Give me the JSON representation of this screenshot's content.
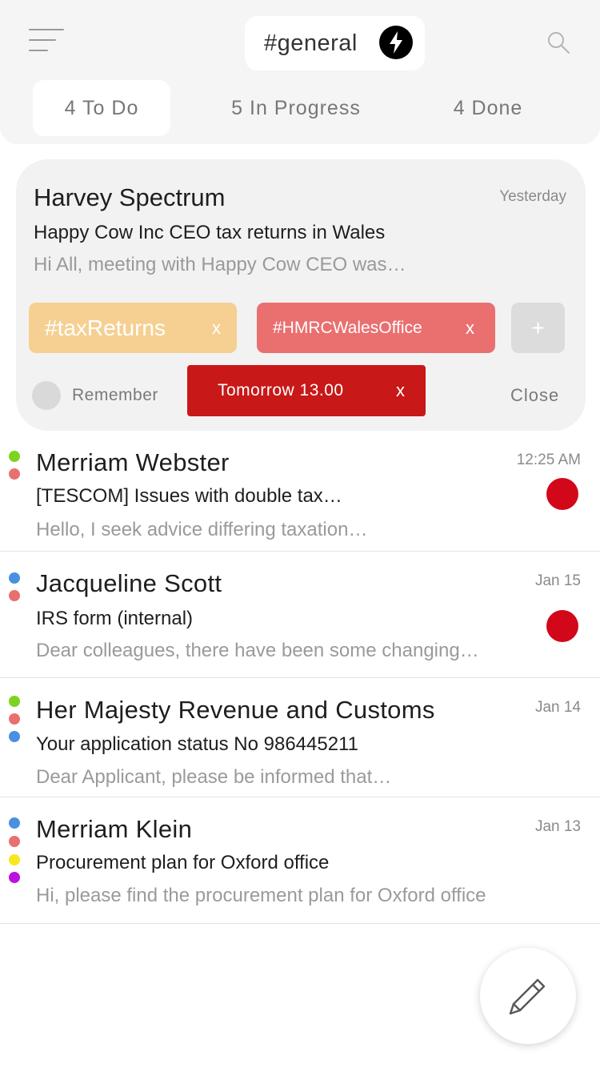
{
  "header": {
    "channel": "#general",
    "tabs": [
      {
        "label": "4 To Do",
        "active": true
      },
      {
        "label": "5 In Progress",
        "active": false
      },
      {
        "label": "4 Done",
        "active": false
      }
    ]
  },
  "expanded_message": {
    "sender": "Harvey Spectrum",
    "time": "Yesterday",
    "subject": "Happy Cow Inc CEO tax returns in Wales",
    "preview": "Hi All, meeting with Happy Cow CEO was…",
    "tags": [
      {
        "label": "#taxReturns",
        "remove": "x",
        "color": "#f5d092"
      },
      {
        "label": "#HMRCWalesOffice",
        "remove": "x",
        "color": "#ea6f6f"
      }
    ],
    "add_tag": "+",
    "remember_label": "Remember",
    "reminder": {
      "label": "Tomorrow 13.00",
      "remove": "x",
      "color": "#c81818"
    },
    "close_label": "Close"
  },
  "messages": [
    {
      "sender": "Merriam Webster",
      "time": "12:25 AM",
      "subject": "[TESCOM] Issues with double tax…",
      "preview": "Hello, I seek advice differing taxation…",
      "label_colors": [
        "#7ed321",
        "#ea6f6f"
      ],
      "unread": true
    },
    {
      "sender": "Jacqueline Scott",
      "time": "Jan 15",
      "subject": "IRS form (internal)",
      "preview": "Dear colleagues, there have been some changing…",
      "label_colors": [
        "#4a90e2",
        "#ea6f6f"
      ],
      "unread": true
    },
    {
      "sender": "Her Majesty Revenue and Customs",
      "time": "Jan 14",
      "subject": "Your application status No 986445211",
      "preview": "Dear Applicant, please be informed that…",
      "label_colors": [
        "#7ed321",
        "#ea6f6f",
        "#4a90e2"
      ],
      "unread": false
    },
    {
      "sender": "Merriam Klein",
      "time": "Jan 13",
      "subject": "Procurement plan for Oxford office",
      "preview": "Hi, please find the procurement plan for Oxford office",
      "label_colors": [
        "#4a90e2",
        "#ea6f6f",
        "#f8e71c",
        "#bd10e0"
      ],
      "unread": false
    }
  ],
  "icons": {
    "menu": "hamburger-menu-icon",
    "channel": "lightning-bolt-icon",
    "search": "search-icon",
    "compose": "pencil-icon"
  }
}
